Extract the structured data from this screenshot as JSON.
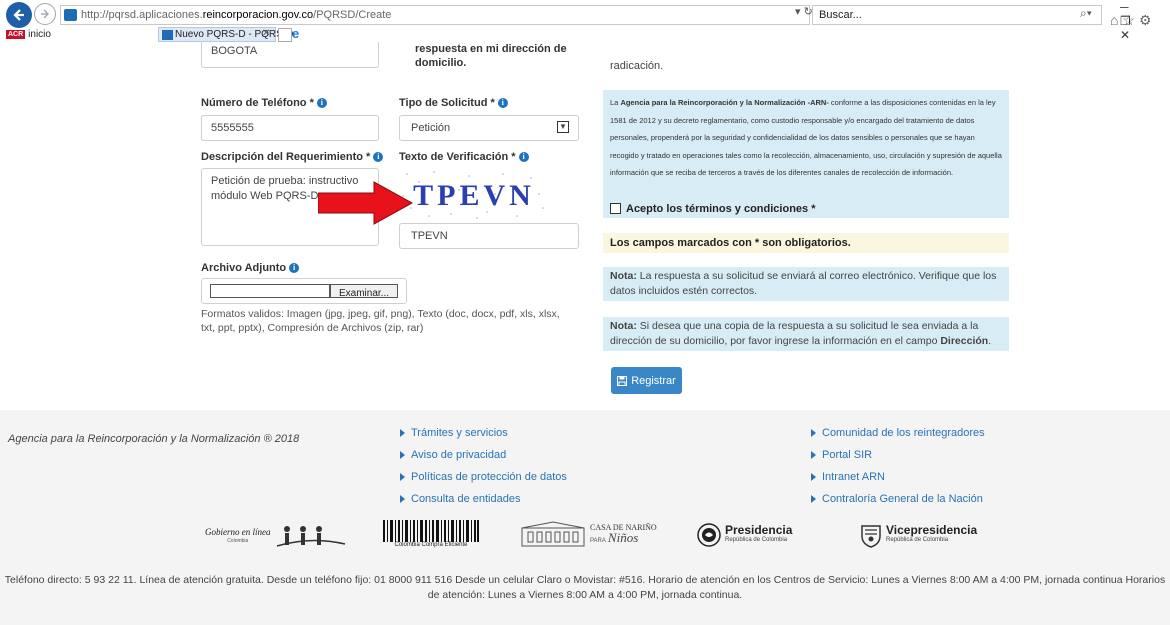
{
  "browser": {
    "url_prefix": "http://pqrsd.aplicaciones.",
    "url_domain": "reincorporacion.gov.co",
    "url_path": "/PQRSD/Create",
    "addr_controls": "▾ ↻",
    "search_placeholder": "Buscar...",
    "window_controls": "─ ❐ ✕",
    "favorites_item": "inicio",
    "favorites_badge": "ACR",
    "tab_title": "Nuevo PQRS-D - PQRS-D",
    "tab_close": "✕"
  },
  "form": {
    "city_value": "BOGOTA",
    "address_checkbox_label": "respuesta en mi dirección de domicilio.",
    "phone_label": "Número de Teléfono *",
    "phone_value": "5555555",
    "request_type_label": "Tipo de Solicitud *",
    "request_type_value": "Petición",
    "description_label": "Descripción del Requerimiento *",
    "description_value": "Petición de prueba: instructivo módulo Web PQRS-D.",
    "verification_label": "Texto de Verificación *",
    "captcha_text": "TPEVN",
    "verification_value": "TPEVN",
    "attachment_label": "Archivo Adjunto",
    "browse_button": "Examinar...",
    "formats_help": "Formatos validos: Imagen (jpg, jpeg, gif, png), Texto (doc, docx, pdf, xls, xlsx, txt, ppt, pptx), Compresión de Archivos (zip, rar)"
  },
  "right": {
    "radicacion_text": "radicación.",
    "terms_intro": "La ",
    "terms_org": "Agencia para la Reincorporación y la Normalización -ARN-",
    "terms_body": " conforme a las disposiciones contenidas en la ley 1581 de 2012 y su decreto reglamentario, como custodio responsable y/o encargado del tratamiento de datos personales, propenderá por la seguridad y confidencialidad de los datos sensibles o personales que se hayan recogido y tratado en operaciones tales como la recolección, almacenamiento, uso, circulación y supresión de aquella información que se reciba de terceros a través de los diferentes canales de recolección de información.",
    "terms_checkbox_label": "Acepto los términos y condiciones *",
    "required_note": "Los campos marcados con * son obligatorios.",
    "note_label": "Nota:",
    "note1": " La respuesta a su solicitud se enviará al correo electrónico. Verifique que los datos incluidos estén correctos.",
    "note2_a": " Si desea que una copia de la respuesta a su solicitud le sea enviada a la dirección de su domicilio, por favor ingrese la información en el campo ",
    "note2_field": "Dirección",
    "note2_end": ".",
    "submit_label": "Registrar"
  },
  "footer": {
    "copyright": "Agencia para la Reincorporación y la Normalización ® 2018",
    "links_col1": [
      "Trámites y servicios",
      "Aviso de privacidad",
      "Políticas de protección de datos",
      "Consulta de entidades"
    ],
    "links_col2": [
      "Comunidad de los reintegradores",
      "Portal SIR",
      "Intranet ARN",
      "Contraloría General de la Nación"
    ],
    "logos": {
      "gobierno_main": "Gobierno en línea",
      "gobierno_sub": "Colombia",
      "compra_text": "Colombia Compra Eficiente",
      "nariño_top": "CASA DE NARIÑO",
      "nariño_para": "PARA",
      "nariño_ninos": "Niños",
      "presidencia_title": "Presidencia",
      "presidencia_sub": "República de Colombia",
      "vice_title": "Vicepresidencia",
      "vice_sub": "República de Colombia"
    },
    "contact": "Teléfono directo: 5 93 22 11. Línea de atención gratuita. Desde un teléfono fijo: 01 8000 911 516 Desde un celular Claro o Movistar: #516. Horario de atención en los Centros de Servicio: Lunes a Viernes 8:00 AM a 4:00 PM, jornada continua Horarios de atención: Lunes a Viernes 8:00 AM a 4:00 PM, jornada continua."
  },
  "colors": {
    "accent": "#3a87c7",
    "link": "#2a72b5",
    "info_bg": "#d8ecf5",
    "warning_bg": "#fbf6df",
    "arrow": "#e8121a"
  }
}
